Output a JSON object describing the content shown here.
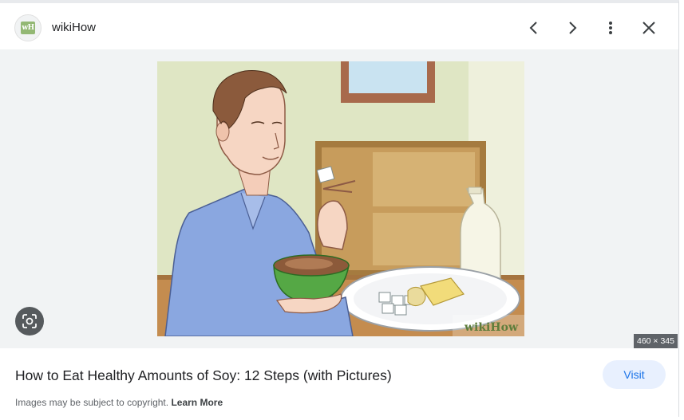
{
  "header": {
    "favicon_text": "wH",
    "site_name": "wikiHow",
    "buttons": {
      "prev_icon": "chevron-left-icon",
      "next_icon": "chevron-right-icon",
      "more_icon": "more-vert-icon",
      "close_icon": "close-icon"
    }
  },
  "image": {
    "watermark": "wikiHow",
    "dimensions": "460 × 345",
    "lens_icon": "lens-icon"
  },
  "result": {
    "title": "How to Eat Healthy Amounts of Soy: 12 Steps (with Pictures)",
    "visit_label": "Visit",
    "copyright_text": "Images may be subject to copyright.",
    "learn_more_label": "Learn More"
  },
  "colors": {
    "accent": "#1a73e8",
    "visit_bg": "#e8f0fe",
    "image_bg": "#f1f3f4"
  }
}
